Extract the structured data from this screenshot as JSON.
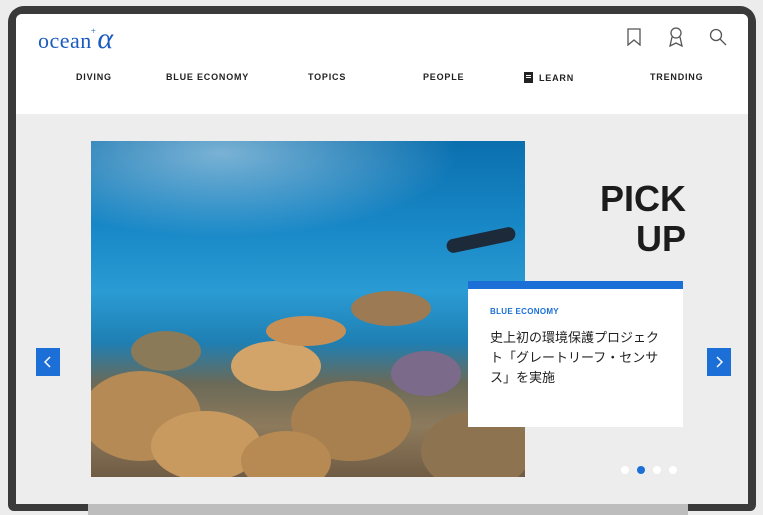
{
  "logo": {
    "text": "ocean",
    "alpha": "α",
    "sup": "+"
  },
  "header_icons": [
    "bookmark-icon",
    "award-icon",
    "search-icon"
  ],
  "nav": [
    {
      "label": "DIVING"
    },
    {
      "label": "BLUE ECONOMY"
    },
    {
      "label": "TOPICS"
    },
    {
      "label": "PEOPLE"
    },
    {
      "label": "LEARN"
    },
    {
      "label": "TRENDING"
    }
  ],
  "hero": {
    "pickup_line1": "PICK",
    "pickup_line2": "UP",
    "category": "BLUE ECONOMY",
    "title": "史上初の環境保護プロジェクト「グレートリーフ・センサス」を実施",
    "prev_icon": "chevron-left-icon",
    "next_icon": "chevron-right-icon",
    "slides_total": 4,
    "active_slide": 2
  },
  "colors": {
    "accent": "#1b6fd6",
    "logo": "#1b5bbf"
  }
}
